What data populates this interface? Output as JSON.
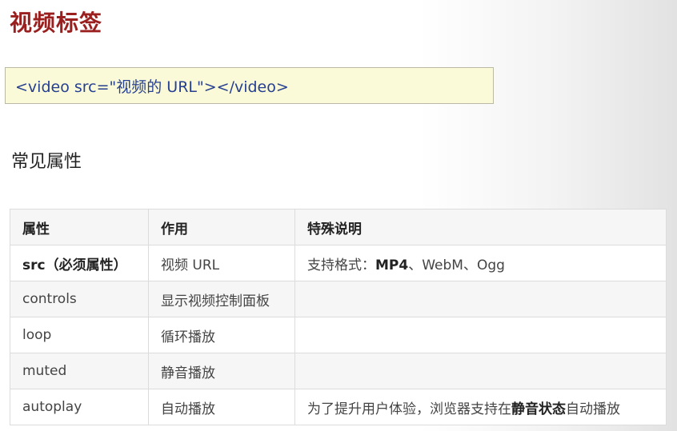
{
  "title": "视频标签",
  "code_example": "<video src=\"视频的 URL\"></video>",
  "section_heading": "常见属性",
  "table": {
    "headers": [
      "属性",
      "作用",
      "特殊说明"
    ],
    "rows": [
      {
        "attr": "src（必须属性）",
        "effect": "视频 URL",
        "note_prefix": "支持格式：",
        "note_bold": "MP4",
        "note_suffix": "、WebM、Ogg"
      },
      {
        "attr": "controls",
        "effect": "显示视频控制面板"
      },
      {
        "attr": "loop",
        "effect": "循环播放"
      },
      {
        "attr": "muted",
        "effect": "静音播放"
      },
      {
        "attr": "autoplay",
        "effect": "自动播放",
        "note_prefix": "为了提升用户体验，浏览器支持在",
        "note_bold": "静音状态",
        "note_suffix": "自动播放"
      }
    ]
  }
}
